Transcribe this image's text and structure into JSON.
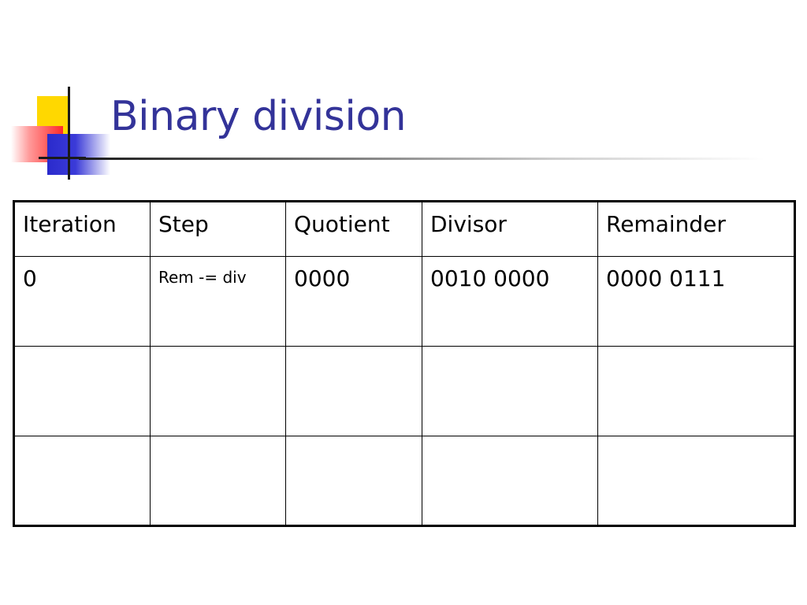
{
  "slide": {
    "title": "Binary division"
  },
  "table": {
    "headers": [
      "Iteration",
      "Step",
      "Quotient",
      "Divisor",
      "Remainder"
    ],
    "rows": [
      [
        "0",
        "Rem -= div",
        "0000",
        "0010 0000",
        "0000 0111"
      ],
      [
        "",
        "",
        "",
        "",
        ""
      ],
      [
        "",
        "",
        "",
        "",
        ""
      ]
    ]
  }
}
